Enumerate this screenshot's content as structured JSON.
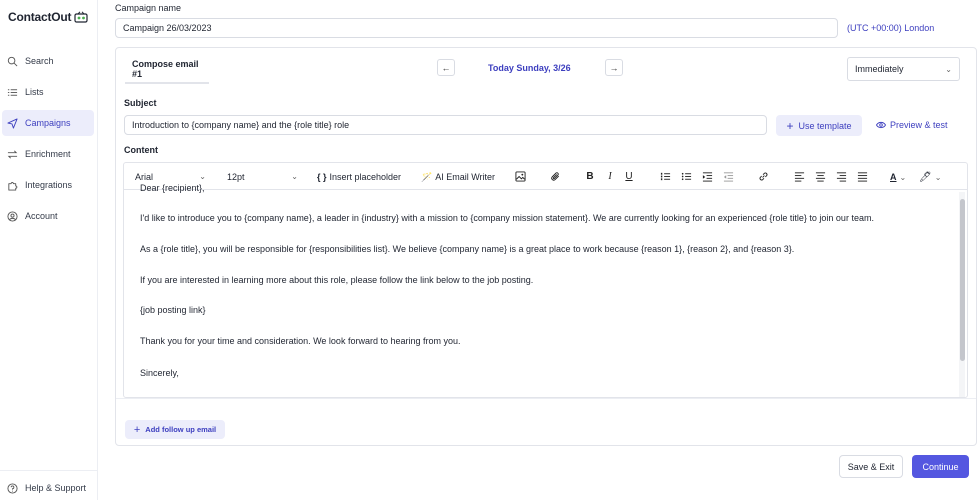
{
  "app": {
    "logo_text": "ContactOut",
    "brand_color": "#3d3fbf",
    "accent_button_color": "#5457e0"
  },
  "sidebar": {
    "items": [
      {
        "label": "Search",
        "icon": "search-icon",
        "active": false
      },
      {
        "label": "Lists",
        "icon": "list-icon",
        "active": false
      },
      {
        "label": "Campaigns",
        "icon": "send-icon",
        "active": true
      },
      {
        "label": "Enrichment",
        "icon": "swap-icon",
        "active": false
      },
      {
        "label": "Integrations",
        "icon": "puzzle-icon",
        "active": false
      },
      {
        "label": "Account",
        "icon": "user-circle-icon",
        "active": false
      }
    ],
    "help": {
      "label": "Help & Support",
      "icon": "question-circle-icon"
    }
  },
  "campaign": {
    "name_label": "Campaign name",
    "name_value": "Campaign 26/03/2023",
    "timezone": "(UTC +00:00) London"
  },
  "compose": {
    "tab_label": "Compose email #1",
    "prev_label": "←",
    "next_label": "→",
    "date_label": "Today Sunday, 3/26",
    "schedule_value": "Immediately",
    "subject_label": "Subject",
    "subject_value": "Introduction to {company name} and the {role title} role",
    "use_template_label": "Use template",
    "preview_label": "Preview & test",
    "content_label": "Content"
  },
  "toolbar": {
    "font_value": "Arial",
    "size_value": "12pt",
    "insert_placeholder_label": "Insert placeholder",
    "ai_writer_label": "AI Email Writer",
    "bold": "B",
    "italic": "I",
    "underline": "U",
    "text_color": "A"
  },
  "email_body": [
    "Dear {recipient},",
    "I'd like to introduce you to {company name}, a leader in {industry} with a mission to {company mission statement}. We are currently looking for an experienced {role title} to join our team.",
    "As a {role title}, you will be responsible for {responsibilities list}. We believe {company name} is a great place to work because {reason 1}, {reason 2}, and {reason 3}.",
    "If you are interested in learning more about this role, please follow the link below to the job posting.",
    "{job posting link}",
    "Thank you for your time and consideration. We look forward to hearing from you.",
    "Sincerely,"
  ],
  "footer": {
    "follow_up_label": "Add follow up email",
    "save_exit_label": "Save & Exit",
    "continue_label": "Continue"
  }
}
